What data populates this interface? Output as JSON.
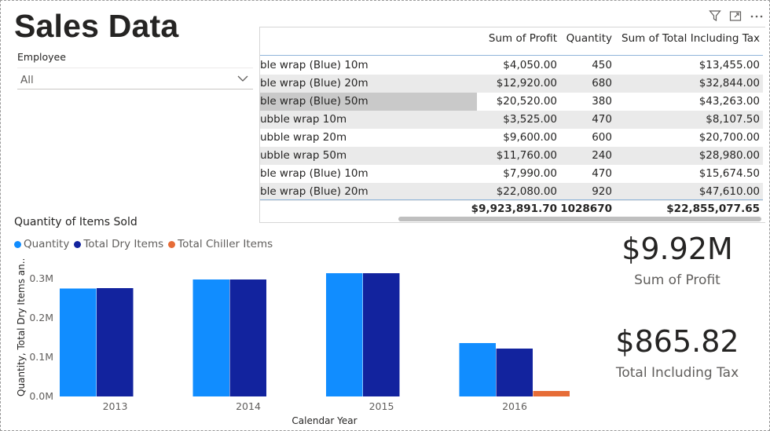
{
  "page": {
    "title": "Sales Data"
  },
  "slicer": {
    "label": "Employee",
    "value": "All"
  },
  "table": {
    "columns": [
      "Sum of Profit",
      "Quantity",
      "Sum of Total Including Tax"
    ],
    "rows": [
      {
        "item": "ble wrap (Blue) 10m",
        "profit": "$4,050.00",
        "qty": "450",
        "total": "$13,455.00"
      },
      {
        "item": "ble wrap (Blue) 20m",
        "profit": "$12,920.00",
        "qty": "680",
        "total": "$32,844.00"
      },
      {
        "item": "ble wrap (Blue) 50m",
        "profit": "$20,520.00",
        "qty": "380",
        "total": "$43,263.00"
      },
      {
        "item": "ubble wrap 10m",
        "profit": "$3,525.00",
        "qty": "470",
        "total": "$8,107.50"
      },
      {
        "item": "ubble wrap 20m",
        "profit": "$9,600.00",
        "qty": "600",
        "total": "$20,700.00"
      },
      {
        "item": "ubble wrap 50m",
        "profit": "$11,760.00",
        "qty": "240",
        "total": "$28,980.00"
      },
      {
        "item": "ble wrap (Blue) 10m",
        "profit": "$7,990.00",
        "qty": "470",
        "total": "$15,674.50"
      },
      {
        "item": "ble wrap (Blue) 20m",
        "profit": "$22,080.00",
        "qty": "920",
        "total": "$47,610.00"
      }
    ],
    "selected_row": 2,
    "totals": {
      "profit": "$9,923,891.70",
      "qty": "1028670",
      "total": "$22,855,077.65"
    }
  },
  "icons": [
    "filter-icon",
    "focus-mode-icon",
    "more-options-icon"
  ],
  "chart_data": {
    "type": "bar",
    "title": "Quantity of Items Sold",
    "xlabel": "Calendar Year",
    "ylabel": "Quantity, Total Dry Items an...",
    "categories": [
      "2013",
      "2014",
      "2015",
      "2016"
    ],
    "series": [
      {
        "name": "Quantity",
        "color": "#118DFF",
        "values": [
          275000,
          298000,
          314000,
          136000
        ]
      },
      {
        "name": "Total Dry Items",
        "color": "#12239E",
        "values": [
          276000,
          298000,
          314000,
          122000
        ]
      },
      {
        "name": "Total Chiller Items",
        "color": "#E66C37",
        "values": [
          0,
          0,
          0,
          14000
        ]
      }
    ],
    "yticks": [
      "0.0M",
      "0.1M",
      "0.2M",
      "0.3M"
    ],
    "ylim": [
      0,
      350000
    ],
    "legend_position": "top-left",
    "grid": false
  },
  "cards": [
    {
      "value": "$9.92M",
      "label": "Sum of Profit"
    },
    {
      "value": "$865.82",
      "label": "Total Including Tax"
    }
  ]
}
